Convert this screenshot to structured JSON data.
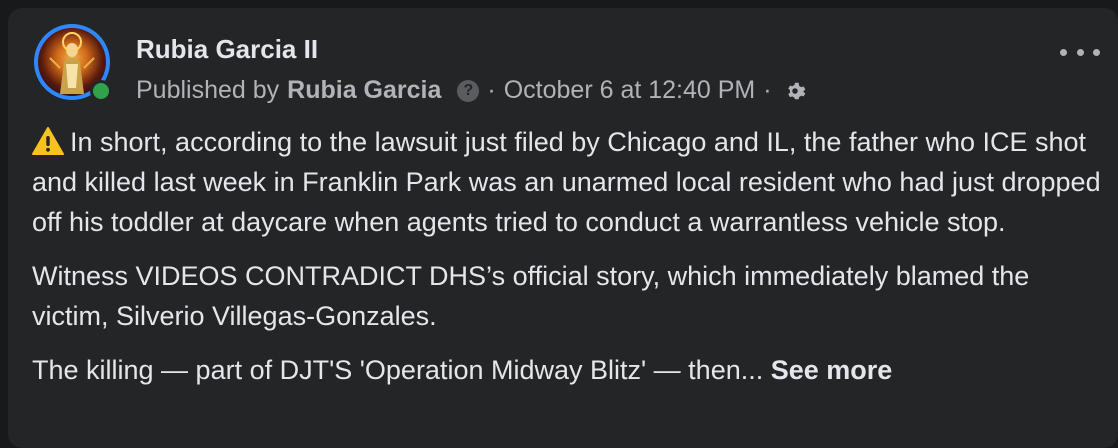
{
  "post": {
    "page_name": "Rubia Garcia II",
    "published_prefix": "Published by",
    "publisher": "Rubia Garcia",
    "help_glyph": "?",
    "separator": "·",
    "timestamp": "October 6 at 12:40 PM",
    "paragraphs": {
      "p1": "In short, according to the lawsuit just filed by Chicago and IL, the father who ICE shot and killed last week in Franklin Park was an unarmed local resident who had just dropped off his toddler at daycare when agents tried to conduct a warrantless vehicle stop.",
      "p2": "Witness VIDEOS CONTRADICT DHS’s official story, which immediately blamed the victim, Silverio Villegas-Gonzales.",
      "p3": "The killing — part of DJT'S 'Operation Midway Blitz' — then..."
    },
    "see_more_label": "See more",
    "icons": {
      "warning": "warning-icon",
      "more": "more-options-icon",
      "privacy": "gear-icon"
    }
  },
  "colors": {
    "background": "#18191a",
    "card": "#242526",
    "primary_text": "#e4e6eb",
    "secondary_text": "#b0b3b8",
    "avatar_ring": "#2d88ff",
    "online": "#31a24c"
  }
}
